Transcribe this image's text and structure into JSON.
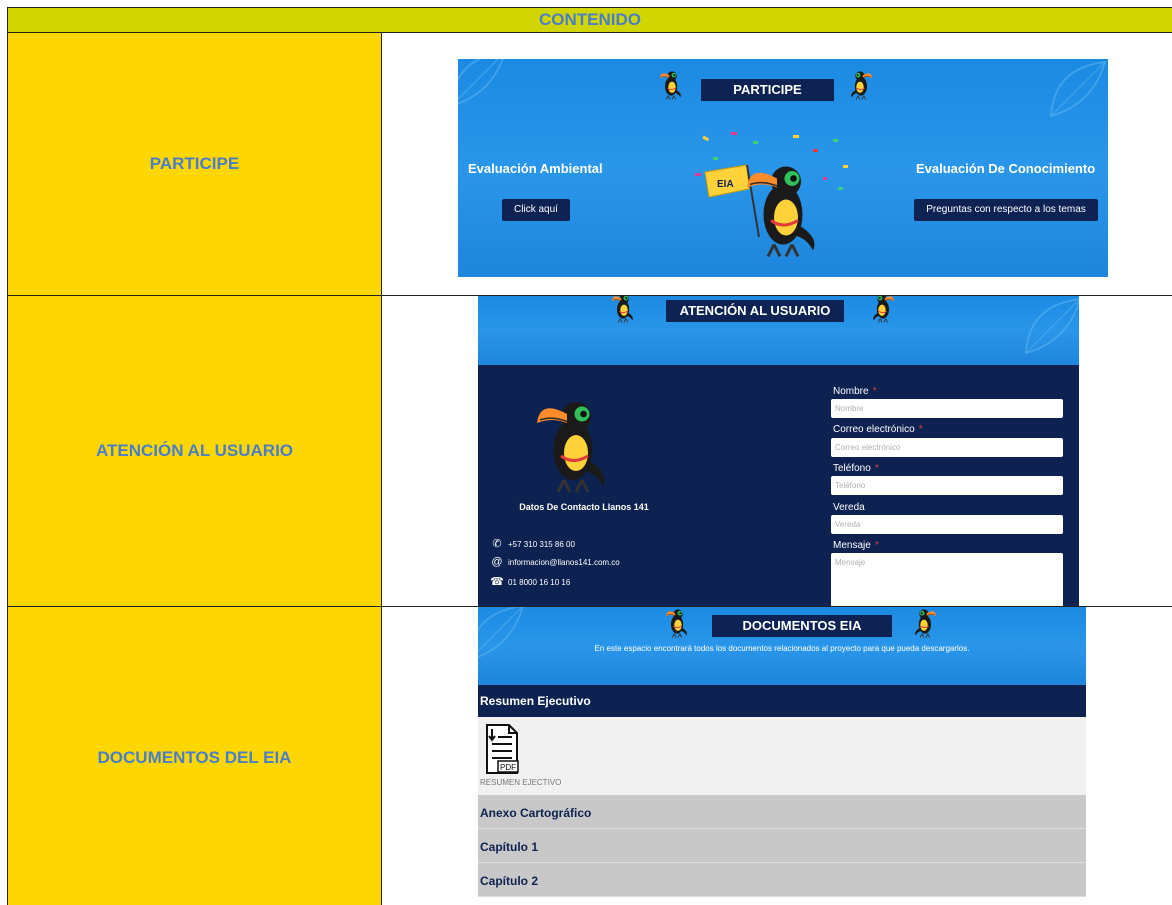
{
  "header": {
    "title": "CONTENIDO"
  },
  "rows": [
    {
      "label": "PARTICIPE"
    },
    {
      "label": "ATENCIÓN AL USUARIO"
    },
    {
      "label": "DOCUMENTOS DEL EIA"
    }
  ],
  "participe": {
    "title": "PARTICIPE",
    "left_heading": "Evaluación Ambiental",
    "left_button": "Click aquí",
    "right_heading": "Evaluación De Conocimiento",
    "right_button": "Preguntas con respecto a los temas",
    "flag_text": "EIA"
  },
  "atencion": {
    "title": "ATENCIÓN AL USUARIO",
    "contact_title": "Datos De Contacto Llanos 141",
    "contacts": [
      {
        "icon": "whatsapp-icon",
        "text": "+57 310 315 86 00"
      },
      {
        "icon": "at-icon",
        "text": "informacion@llanos141.com.co"
      },
      {
        "icon": "phone-icon",
        "text": "01 8000 16 10 16"
      }
    ],
    "form": {
      "nombre_label": "Nombre",
      "nombre_placeholder": "Nombre",
      "correo_label": "Correo electrónico",
      "correo_placeholder": "Correo electrónico",
      "telefono_label": "Teléfono",
      "telefono_placeholder": "Teléfono",
      "vereda_label": "Vereda",
      "vereda_placeholder": "Vereda",
      "mensaje_label": "Mensaje",
      "mensaje_placeholder": "Mensaje",
      "required_mark": "*"
    }
  },
  "documentos": {
    "title": "DOCUMENTOS EIA",
    "subtitle": "En este espacio encontrará todos los documentos relacionados al proyecto para que pueda descargarlos.",
    "sections": [
      "Resumen Ejecutivo",
      "Anexo Cartográfico",
      "Capítulo 1",
      "Capítulo 2"
    ],
    "pdf_badge": "PDF",
    "file_caption": "RESUMEN EJECTIVO"
  },
  "colors": {
    "header_bg": "#d2d600",
    "label_bg": "#ffd700",
    "label_text": "#4a7ec8",
    "navy": "#0d2250",
    "sky_blue": "#1b8ae2"
  }
}
